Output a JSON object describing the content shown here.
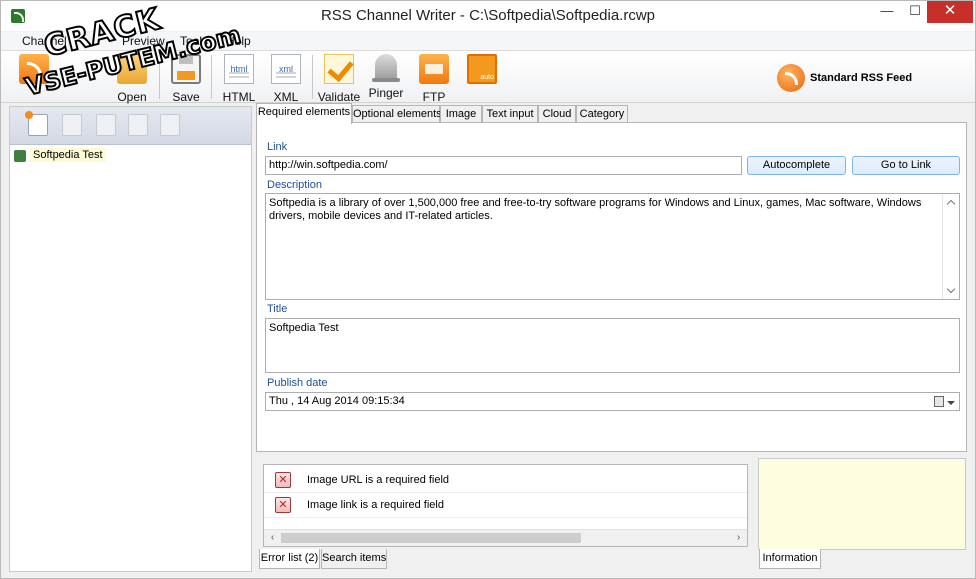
{
  "window": {
    "title": "RSS Channel Writer - C:\\Softpedia\\Softpedia.rcwp",
    "min_glyph": "—",
    "max_glyph": "☐",
    "close_glyph": "✕"
  },
  "menu": [
    "Channel",
    "Preview",
    "Tools",
    "Help"
  ],
  "toolbar": {
    "open_label": "Open",
    "save_label": "Save",
    "html_label": "HTML",
    "html_icon_text": "html",
    "xml_label": "XML",
    "xml_icon_text": "xml",
    "validate_label": "Validate",
    "pinger_label": "Pinger",
    "ftp_label": "FTP",
    "auto_icon_text": "auto",
    "feed_type_label": "Standard RSS Feed"
  },
  "tree": {
    "items": [
      {
        "label": "Softpedia Test"
      }
    ]
  },
  "tabs": [
    "Required elements",
    "Optional elements",
    "Image",
    "Text input",
    "Cloud",
    "Category"
  ],
  "form": {
    "link_label": "Link",
    "link_value": "http://win.softpedia.com/",
    "autocomplete_label": "Autocomplete",
    "goto_link_label": "Go to Link",
    "description_label": "Description",
    "description_value": "Softpedia is a library of over 1,500,000 free and free-to-try software programs for Windows and Linux, games, Mac software, Windows drivers, mobile devices and IT-related articles.",
    "title_label": "Title",
    "title_value": "Softpedia Test",
    "publish_date_label": "Publish date",
    "publish_date_value": "Thu , 14 Aug 2014 09:15:34"
  },
  "errors": {
    "items": [
      {
        "text": "Image URL is a required field"
      },
      {
        "text": "Image link is a required field"
      }
    ],
    "scroll_left": "‹",
    "scroll_right": "›"
  },
  "bottom_tabs": [
    "Error list (2)",
    "Search items"
  ],
  "info_tab": "Information",
  "watermark": {
    "line1": "CRACK",
    "line2": "VSE-PUTEM.com"
  }
}
